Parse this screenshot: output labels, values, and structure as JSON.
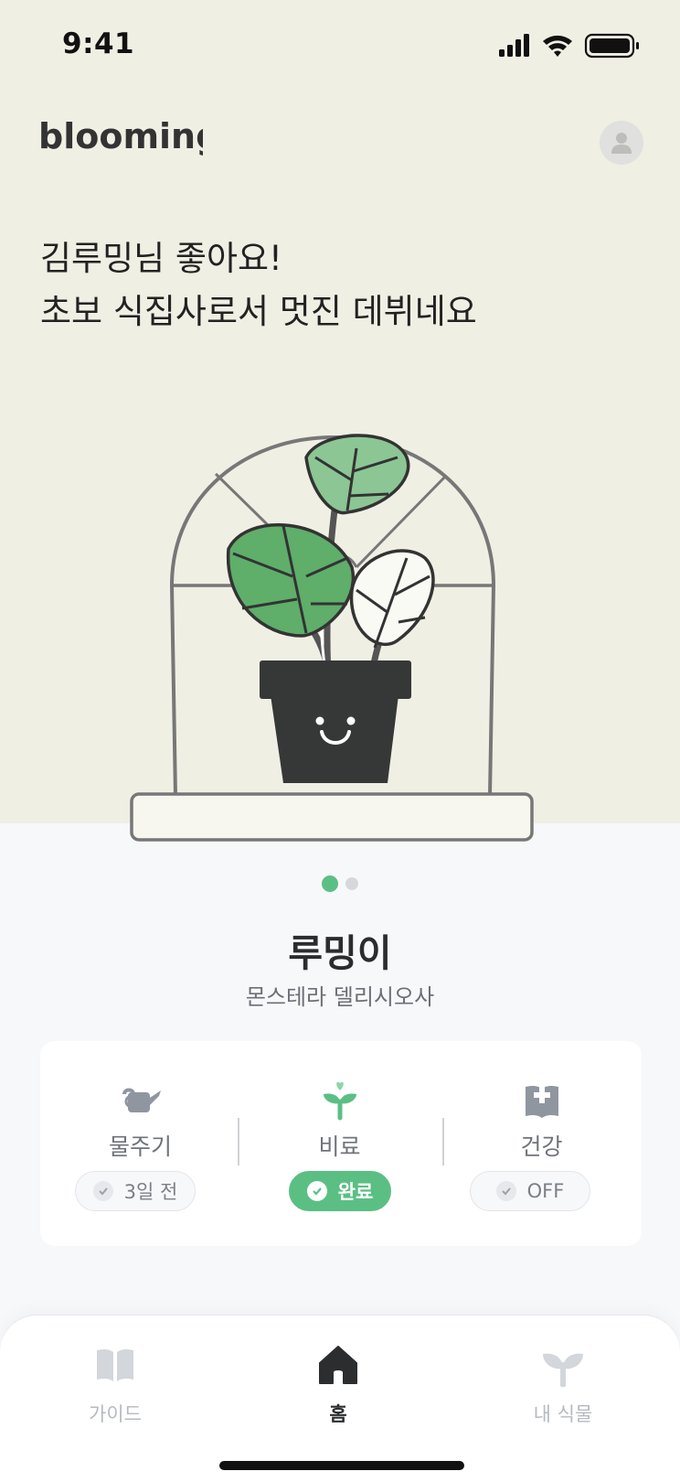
{
  "status_bar": {
    "time": "9:41"
  },
  "header": {
    "logo_text": "blooming",
    "profile_icon": "user-icon"
  },
  "greeting": {
    "line1": "김루밍님 좋아요!",
    "line2": "초보 식집사로서 멋진 데뷔네요"
  },
  "carousel": {
    "current_page": 1,
    "total_pages": 2
  },
  "plant": {
    "name": "루밍이",
    "species": "몬스테라 델리시오사"
  },
  "care": [
    {
      "icon": "watering-can-icon",
      "label": "물주기",
      "status": "3일 전",
      "done": false
    },
    {
      "icon": "sprout-icon",
      "label": "비료",
      "status": "완료",
      "done": true
    },
    {
      "icon": "health-book-icon",
      "label": "건강",
      "status": "OFF",
      "done": false
    }
  ],
  "tabbar": {
    "items": [
      {
        "label": "가이드",
        "icon": "book-icon",
        "active": false
      },
      {
        "label": "홈",
        "icon": "home-icon",
        "active": true
      },
      {
        "label": "내 식물",
        "icon": "sprout-icon",
        "active": false
      }
    ]
  },
  "colors": {
    "accent": "#5bbf84",
    "hero_bg": "#f0efe4",
    "pot": "#363838"
  }
}
